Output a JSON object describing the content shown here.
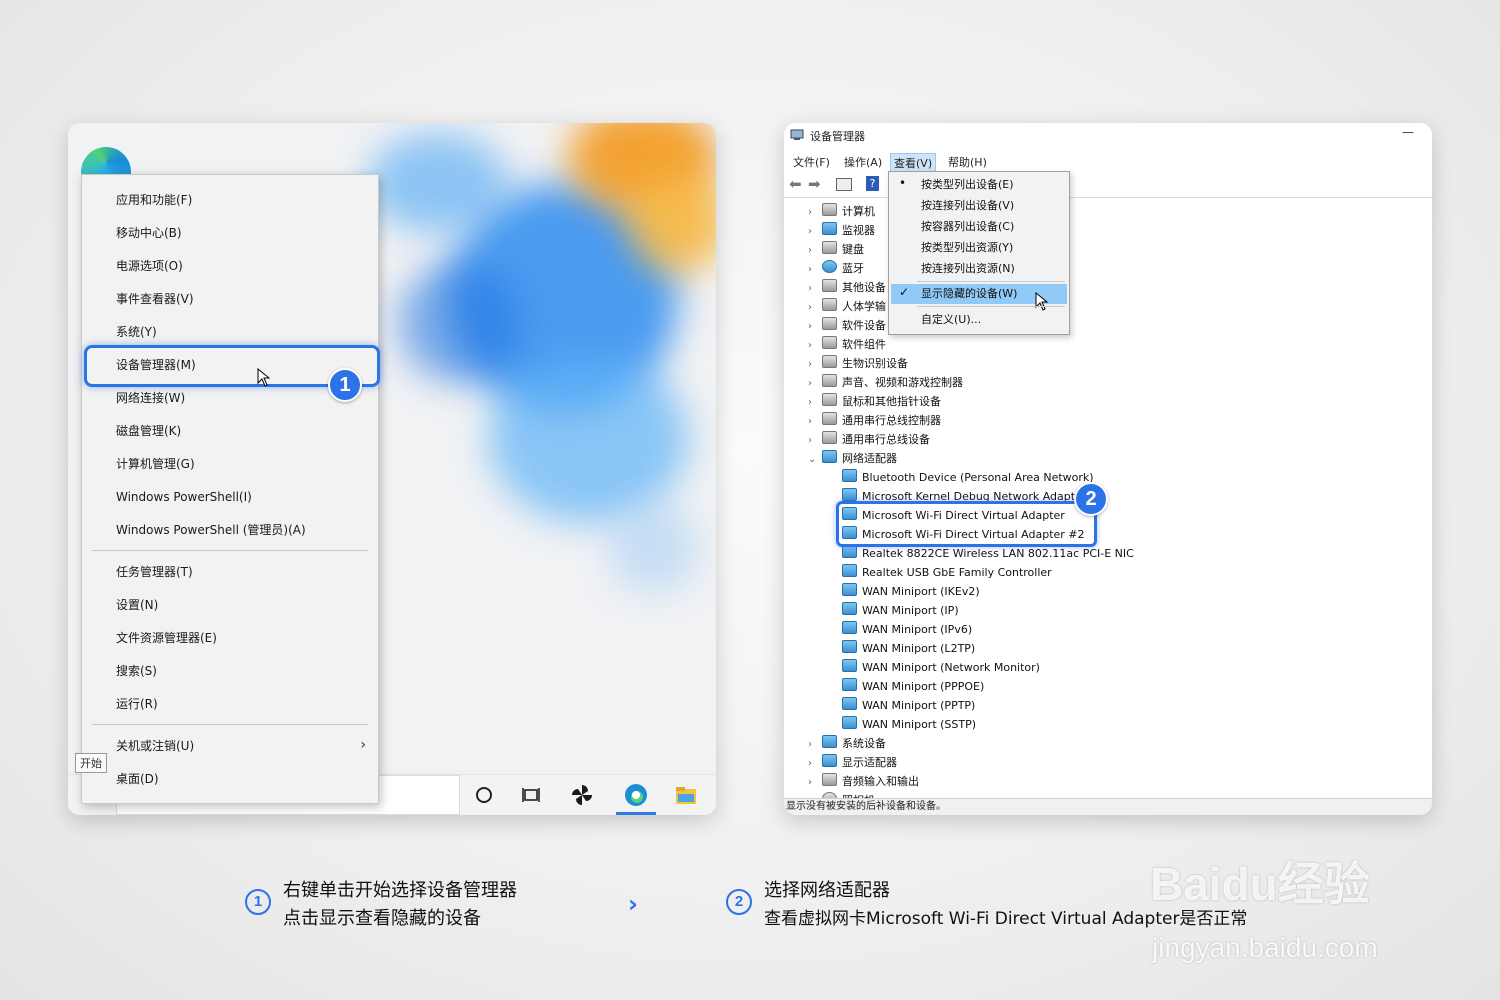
{
  "context_menu": {
    "items": [
      "应用和功能(F)",
      "移动中心(B)",
      "电源选项(O)",
      "事件查看器(V)",
      "系统(Y)",
      "设备管理器(M)",
      "网络连接(W)",
      "磁盘管理(K)",
      "计算机管理(G)",
      "Windows PowerShell(I)",
      "Windows PowerShell (管理员)(A)",
      "任务管理器(T)",
      "设置(N)",
      "文件资源管理器(E)",
      "搜索(S)",
      "运行(R)",
      "关机或注销(U)",
      "桌面(D)"
    ],
    "start_tooltip": "开始"
  },
  "device_manager": {
    "title": "设备管理器",
    "menus": [
      "文件(F)",
      "操作(A)",
      "查看(V)",
      "帮助(H)"
    ],
    "view_menu": {
      "items": [
        "按类型列出设备(E)",
        "按连接列出设备(V)",
        "按容器列出设备(C)",
        "按类型列出资源(Y)",
        "按连接列出资源(N)",
        "显示隐藏的设备(W)",
        "自定义(U)..."
      ]
    },
    "tree": {
      "categories_top": [
        "计算机",
        "监视器",
        "键盘",
        "蓝牙",
        "其他设备",
        "人体学输",
        "软件设备",
        "软件组件",
        "生物识别设备",
        "声音、视频和游戏控制器",
        "鼠标和其他指针设备",
        "通用串行总线控制器",
        "通用串行总线设备"
      ],
      "network_category": "网络适配器",
      "adapters": [
        "Bluetooth Device (Personal Area Network)",
        "Microsoft Kernel Debug Network Adapt",
        "Microsoft Wi-Fi Direct Virtual Adapter",
        "Microsoft Wi-Fi Direct Virtual Adapter #2",
        "Realtek 8822CE Wireless LAN 802.11ac PCI-E NIC",
        "Realtek USB GbE Family Controller",
        "WAN Miniport (IKEv2)",
        "WAN Miniport (IP)",
        "WAN Miniport (IPv6)",
        "WAN Miniport (L2TP)",
        "WAN Miniport (Network Monitor)",
        "WAN Miniport (PPPOE)",
        "WAN Miniport (PPTP)",
        "WAN Miniport (SSTP)"
      ],
      "categories_bottom": [
        "系统设备",
        "显示适配器",
        "音频输入和输出",
        "照相机"
      ]
    },
    "status": "显示没有被安装的后补设备和设备。"
  },
  "badges": [
    "1",
    "2"
  ],
  "captions": {
    "step1": {
      "num": "1",
      "line1": "右键单击开始选择设备管理器",
      "line2": "点击显示查看隐藏的设备"
    },
    "step2": {
      "num": "2",
      "line1": "选择网络适配器",
      "line2": "查看虚拟网卡Microsoft Wi-Fi Direct Virtual Adapter是否正常"
    }
  },
  "watermark": {
    "main": "Baidu经验",
    "sub": "jingyan.baidu.com"
  },
  "colors": {
    "accent": "#2d73e8",
    "menu_hover": "#91c9f7"
  }
}
